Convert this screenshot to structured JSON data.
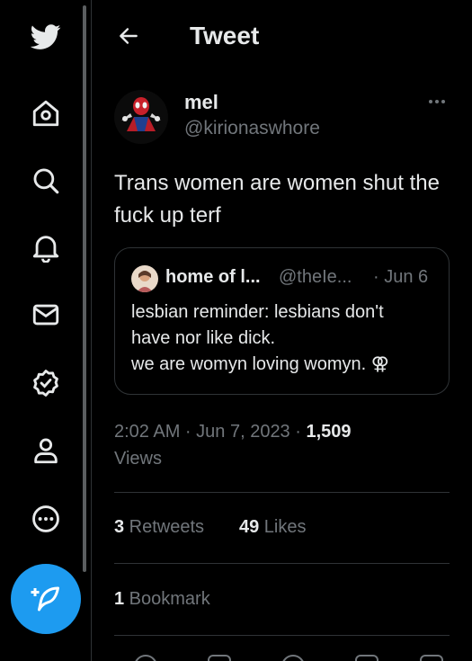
{
  "sidebar": {
    "logo": "twitter-bird-icon",
    "items": [
      {
        "icon": "home-icon"
      },
      {
        "icon": "search-icon"
      },
      {
        "icon": "bell-icon"
      },
      {
        "icon": "mail-icon"
      },
      {
        "icon": "verified-badge-icon"
      },
      {
        "icon": "profile-icon"
      },
      {
        "icon": "more-circle-icon"
      }
    ],
    "compose_icon": "compose-feather-icon"
  },
  "header": {
    "back_icon": "arrow-left-icon",
    "title": "Tweet"
  },
  "tweet": {
    "author_name": "mel",
    "author_handle": "@kirionaswhore",
    "more_icon": "more-dots-icon",
    "text": "Trans women are women shut the fuck up terf",
    "quote": {
      "author_name": "home of l...",
      "author_handle": "@theIe...",
      "date": "· Jun 6",
      "lines": [
        "lesbian reminder: lesbians don't",
        "have nor like dick.",
        "we are womyn loving womyn. ⚢"
      ]
    },
    "time": "2:02 AM · Jun 7, 2023 · ",
    "views_count": "1,509",
    "views_label": "Views",
    "retweets_count": "3",
    "retweets_label": " Retweets",
    "likes_count": "49",
    "likes_label": " Likes",
    "bookmarks_count": "1",
    "bookmarks_label": " Bookmark"
  },
  "colors": {
    "background": "#000000",
    "text": "#e7e9ea",
    "secondary": "#71767b",
    "accent": "#1d9bf0",
    "border": "#2f3336"
  }
}
